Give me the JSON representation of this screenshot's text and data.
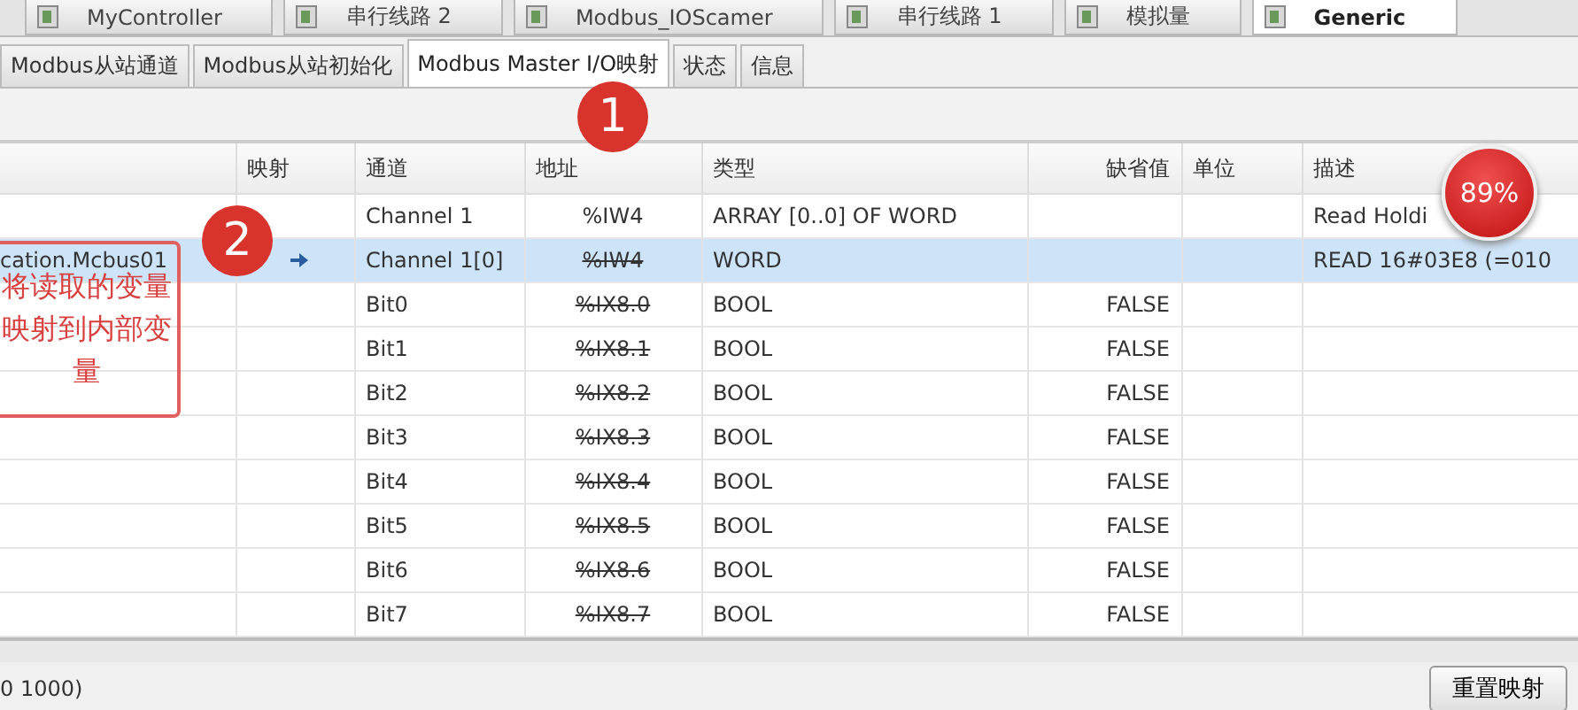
{
  "document_tabs": [
    {
      "label": "MyController",
      "selected": false
    },
    {
      "label": "串行线路 2",
      "selected": false
    },
    {
      "label": "Modbus_IOScamer",
      "selected": false
    },
    {
      "label": "串行线路 1",
      "selected": false
    },
    {
      "label": "模拟量",
      "selected": false
    },
    {
      "label": "Generic",
      "selected": true
    }
  ],
  "tabs": [
    {
      "label": "Modbus从站通道",
      "selected": false
    },
    {
      "label": "Modbus从站初始化",
      "selected": false
    },
    {
      "label": "Modbus Master I/O映射",
      "selected": true
    },
    {
      "label": "状态",
      "selected": false
    },
    {
      "label": "信息",
      "selected": false
    }
  ],
  "table": {
    "columns": [
      "映射",
      "通道",
      "地址",
      "类型",
      "缺省值",
      "单位",
      "描述"
    ],
    "rows": [
      {
        "variable": "",
        "mapped": false,
        "channel": "Channel 1",
        "address": "%IW4",
        "struck": false,
        "type": "ARRAY [0..0] OF WORD",
        "default": "",
        "unit": "",
        "description": "Read Holdi",
        "selected": false
      },
      {
        "variable": "cation.Mcbus01",
        "mapped": true,
        "channel": "Channel 1[0]",
        "address": "%IW4",
        "struck": true,
        "type": "WORD",
        "default": "",
        "unit": "",
        "description": "READ   16#03E8 (=010",
        "selected": true
      },
      {
        "variable": "",
        "mapped": false,
        "channel": "Bit0",
        "address": "%IX8.0",
        "struck": true,
        "type": "BOOL",
        "default": "FALSE",
        "unit": "",
        "description": "",
        "selected": false
      },
      {
        "variable": "",
        "mapped": false,
        "channel": "Bit1",
        "address": "%IX8.1",
        "struck": true,
        "type": "BOOL",
        "default": "FALSE",
        "unit": "",
        "description": "",
        "selected": false
      },
      {
        "variable": "",
        "mapped": false,
        "channel": "Bit2",
        "address": "%IX8.2",
        "struck": true,
        "type": "BOOL",
        "default": "FALSE",
        "unit": "",
        "description": "",
        "selected": false
      },
      {
        "variable": "",
        "mapped": false,
        "channel": "Bit3",
        "address": "%IX8.3",
        "struck": true,
        "type": "BOOL",
        "default": "FALSE",
        "unit": "",
        "description": "",
        "selected": false
      },
      {
        "variable": "",
        "mapped": false,
        "channel": "Bit4",
        "address": "%IX8.4",
        "struck": true,
        "type": "BOOL",
        "default": "FALSE",
        "unit": "",
        "description": "",
        "selected": false
      },
      {
        "variable": "",
        "mapped": false,
        "channel": "Bit5",
        "address": "%IX8.5",
        "struck": true,
        "type": "BOOL",
        "default": "FALSE",
        "unit": "",
        "description": "",
        "selected": false
      },
      {
        "variable": "",
        "mapped": false,
        "channel": "Bit6",
        "address": "%IX8.6",
        "struck": true,
        "type": "BOOL",
        "default": "FALSE",
        "unit": "",
        "description": "",
        "selected": false
      },
      {
        "variable": "",
        "mapped": false,
        "channel": "Bit7",
        "address": "%IX8.7",
        "struck": true,
        "type": "BOOL",
        "default": "FALSE",
        "unit": "",
        "description": "",
        "selected": false
      }
    ]
  },
  "status_text": "0 1000)",
  "reset_button": "重置映射",
  "badge": "89%",
  "annotations": [
    {
      "label": "1"
    },
    {
      "label": "2",
      "note": "将读取的变量映射到内部变量"
    }
  ]
}
